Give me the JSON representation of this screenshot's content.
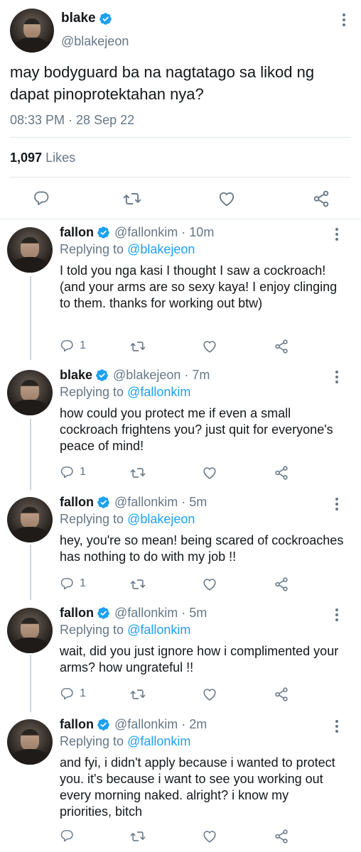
{
  "main_tweet": {
    "name": "blake",
    "handle": "@blakejeon",
    "text": "may bodyguard ba na nagtatago sa likod ng dapat pinoprotektahan nya?",
    "timestamp": "08:33 PM · 28 Sep 22",
    "likes_count": "1,097",
    "likes_label": "Likes",
    "actions": [
      "reply-icon",
      "retweet-icon",
      "like-icon",
      "share-icon"
    ]
  },
  "replies": [
    {
      "name": "fallon",
      "handle": "@fallonkim",
      "time": "· 10m",
      "replying_prefix": "Replying to",
      "replying_to": "@blakejeon",
      "text": "I told you nga kasi I thought I saw a cockroach! (and your arms are so sexy kaya! I enjoy clinging to them. thanks for working out btw)",
      "reply_count": "1"
    },
    {
      "name": "blake",
      "handle": "@blakejeon",
      "time": "· 7m",
      "replying_prefix": "Replying to",
      "replying_to": "@fallonkim",
      "text": "how could you protect me if even a small cockroach frightens you? just quit for everyone's peace of mind!",
      "reply_count": "1"
    },
    {
      "name": "fallon",
      "handle": "@fallonkim",
      "time": "· 5m",
      "replying_prefix": "Replying to",
      "replying_to": "@blakejeon",
      "text": "hey, you're so mean! being scared of cockroaches has nothing to do with my job !!",
      "reply_count": "1"
    },
    {
      "name": "fallon",
      "handle": "@fallonkim",
      "time": "· 5m",
      "replying_prefix": "Replying to",
      "replying_to": "@fallonkim",
      "text": "wait, did you just ignore how i complimented your arms? how ungrateful !!",
      "reply_count": "1"
    },
    {
      "name": "fallon",
      "handle": "@fallonkim",
      "time": "· 2m",
      "replying_prefix": "Replying to",
      "replying_to": "@fallonkim",
      "text": "and fyi, i didn't apply because i wanted to protect you. it's because i want to see you working out every morning naked. alright? i know my priorities, bitch",
      "reply_count": ""
    }
  ],
  "colors": {
    "accent": "#1da1f2",
    "secondary_text": "#657786",
    "primary_text": "#14171a",
    "divider": "#e1e8ed"
  }
}
